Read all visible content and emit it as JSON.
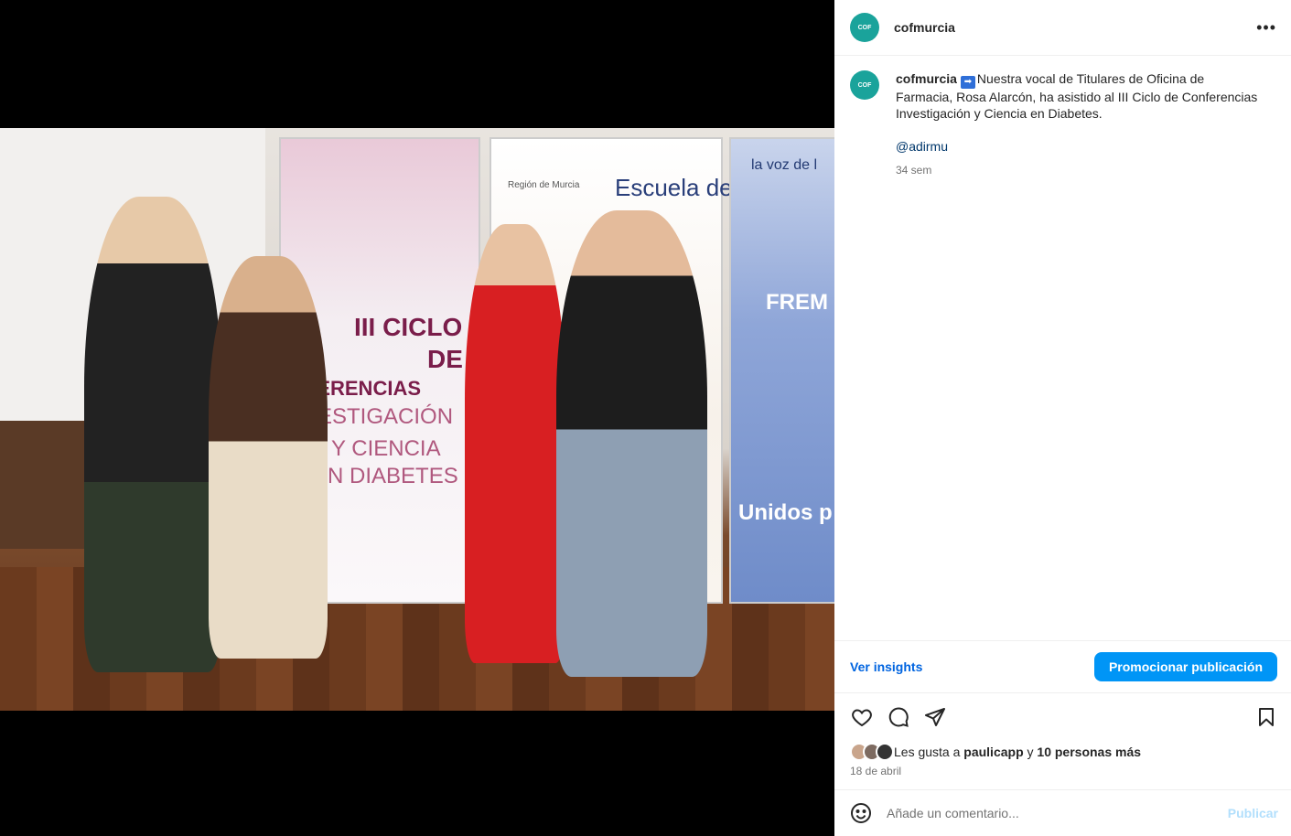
{
  "post": {
    "username": "cofmurcia",
    "avatar_text": "COF",
    "more_icon": "more-horizontal-icon",
    "caption": {
      "username": "cofmurcia",
      "arrow": "➡",
      "text": "Nuestra vocal de Titulares de Oficina de Farmacia, Rosa Alarcón, ha asistido al III Ciclo de Conferencias Investigación y Ciencia en Diabetes.",
      "mention": "@adirmu",
      "time": "34 sem"
    },
    "photo": {
      "banner1": {
        "line1": "III CICLO",
        "line2": "DE",
        "line3": "NFERENCIAS",
        "line4": "ESTIGACIÓN",
        "line5": "Y CIENCIA",
        "line6": "EN DIABETES"
      },
      "banner2": {
        "region": "Región de Murcia",
        "salud": "Escuela de Salud"
      },
      "banner3": {
        "voz": "la voz de l",
        "frem": "FREM",
        "unidos": "Unidos p"
      }
    },
    "insights": {
      "ver_label": "Ver insights",
      "promote_label": "Promocionar publicación"
    },
    "actions": {
      "like_icon": "heart-icon",
      "comment_icon": "comment-icon",
      "share_icon": "share-icon",
      "save_icon": "bookmark-icon"
    },
    "likes": {
      "prefix": "Les gusta a ",
      "user": "paulicapp",
      "middle": " y ",
      "others": "10 personas más"
    },
    "date": "18 de abril",
    "comment": {
      "placeholder": "Añade un comentario...",
      "publish_label": "Publicar"
    }
  }
}
